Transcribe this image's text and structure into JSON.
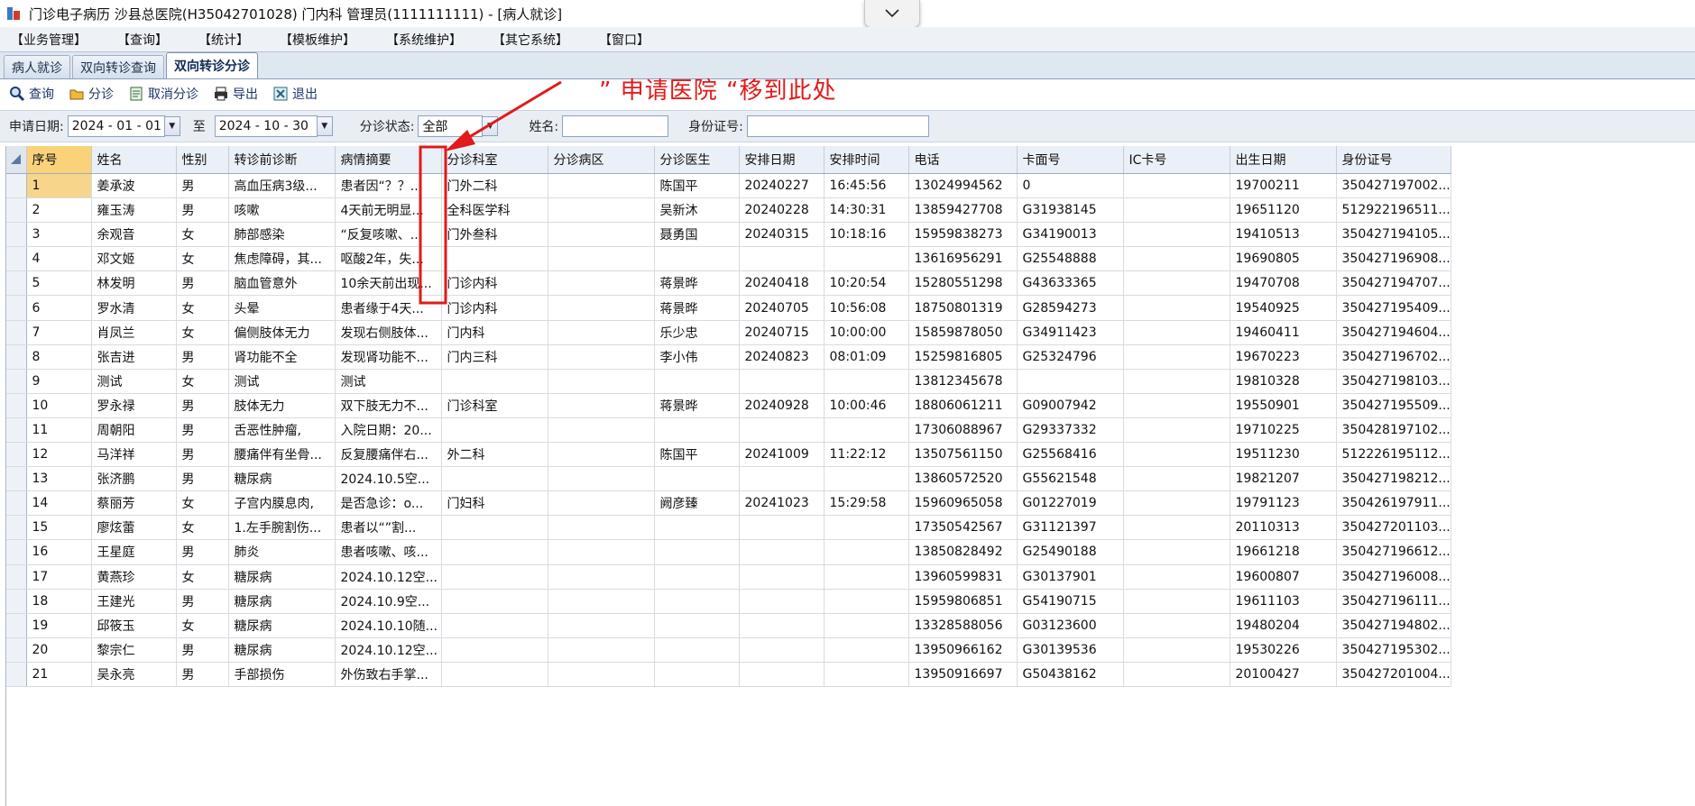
{
  "window": {
    "title": "门诊电子病历  沙县总医院(H35042701028)  门内科  管理员(1111111111) - [病人就诊]"
  },
  "menu": [
    "【业务管理】",
    "【查询】",
    "【统计】",
    "【模板维护】",
    "【系统维护】",
    "【其它系统】",
    "【窗口】"
  ],
  "tabs": [
    {
      "label": "病人就诊",
      "active": false
    },
    {
      "label": "双向转诊查询",
      "active": false
    },
    {
      "label": "双向转诊分诊",
      "active": true
    }
  ],
  "toolbar": {
    "query": "查询",
    "triage": "分诊",
    "cancel_triage": "取消分诊",
    "export": "导出",
    "exit": "退出"
  },
  "annotation": {
    "text": "” 申请医院 “移到此处",
    "color": "#e11a1a"
  },
  "filters": {
    "date_label": "申请日期:",
    "date_from": "2024 - 01 - 01",
    "to_label": "至",
    "date_to": "2024 - 10 - 30",
    "status_label": "分诊状态:",
    "status_value": "全部",
    "name_label": "姓名:",
    "name_value": "",
    "id_label": "身份证号:",
    "id_value": ""
  },
  "table": {
    "columns": [
      "序号",
      "姓名",
      "性别",
      "转诊前诊断",
      "病情摘要",
      "分诊科室",
      "分诊病区",
      "分诊医生",
      "安排日期",
      "安排时间",
      "电话",
      "卡面号",
      "IC卡号",
      "出生日期",
      "身份证号"
    ],
    "rows": [
      [
        "1",
        "姜承波",
        "男",
        "高血压病3级...",
        "患者因“？？...",
        "门外二科",
        "",
        "陈国平",
        "20240227",
        "16:45:56",
        "13024994562",
        "0",
        "",
        "19700211",
        "350427197002..."
      ],
      [
        "2",
        "雍玉涛",
        "男",
        "咳嗽",
        "4天前无明显...",
        "全科医学科",
        "",
        "吴新沐",
        "20240228",
        "14:30:31",
        "13859427708",
        "G31938145",
        "",
        "19651120",
        "512922196511..."
      ],
      [
        "3",
        "余观音",
        "女",
        "肺部感染",
        "“反复咳嗽、...",
        "门外叁科",
        "",
        "聂勇国",
        "20240315",
        "10:18:16",
        "15959838273",
        "G34190013",
        "",
        "19410513",
        "350427194105..."
      ],
      [
        "4",
        "邓文姬",
        "女",
        "焦虑障碍，其...",
        "呕酸2年，失...",
        "",
        "",
        "",
        "",
        "",
        "13616956291",
        "G25548888",
        "",
        "19690805",
        "350427196908..."
      ],
      [
        "5",
        "林发明",
        "男",
        "脑血管意外",
        "10余天前出现...",
        "门诊内科",
        "",
        "蒋景晔",
        "20240418",
        "10:20:54",
        "15280551298",
        "G43633365",
        "",
        "19470708",
        "350427194707..."
      ],
      [
        "6",
        "罗水清",
        "女",
        "头晕",
        "患者缘于4天...",
        "门诊内科",
        "",
        "蒋景晔",
        "20240705",
        "10:56:08",
        "18750801319",
        "G28594273",
        "",
        "19540925",
        "350427195409..."
      ],
      [
        "7",
        "肖凤兰",
        "女",
        "偏侧肢体无力",
        "发现右侧肢体...",
        "门内科",
        "",
        "乐少忠",
        "20240715",
        "10:00:00",
        "15859878050",
        "G34911423",
        "",
        "19460411",
        "350427194604..."
      ],
      [
        "8",
        "张吉进",
        "男",
        "肾功能不全",
        "发现肾功能不...",
        "门内三科",
        "",
        "李小伟",
        "20240823",
        "08:01:09",
        "15259816805",
        "G25324796",
        "",
        "19670223",
        "350427196702..."
      ],
      [
        "9",
        "测试",
        "女",
        "测试",
        "测试",
        "",
        "",
        "",
        "",
        "",
        "13812345678",
        "",
        "",
        "19810328",
        "350427198103..."
      ],
      [
        "10",
        "罗永禄",
        "男",
        "肢体无力",
        "双下肢无力不...",
        "门诊科室",
        "",
        "蒋景晔",
        "20240928",
        "10:00:46",
        "18806061211",
        "G09007942",
        "",
        "19550901",
        "350427195509..."
      ],
      [
        "11",
        "周朝阳",
        "男",
        "舌恶性肿瘤,",
        "入院日期：20...",
        "",
        "",
        "",
        "",
        "",
        "17306088967",
        "G29337332",
        "",
        "19710225",
        "350428197102..."
      ],
      [
        "12",
        "马洋祥",
        "男",
        "腰痛伴有坐骨...",
        "反复腰痛伴右...",
        "外二科",
        "",
        "陈国平",
        "20241009",
        "11:22:12",
        "13507561150",
        "G25568416",
        "",
        "19511230",
        "512226195112..."
      ],
      [
        "13",
        "张济鹏",
        "男",
        "糖尿病",
        "2024.10.5空...",
        "",
        "",
        "",
        "",
        "",
        "13860572520",
        "G55621548",
        "",
        "19821207",
        "350427198212..."
      ],
      [
        "14",
        "蔡丽芳",
        "女",
        "子宫内膜息肉,",
        "是否急诊：o...",
        "门妇科",
        "",
        "阙彦臻",
        "20241023",
        "15:29:58",
        "15960965058",
        "G01227019",
        "",
        "19791123",
        "350426197911..."
      ],
      [
        "15",
        "廖炫蕾",
        "女",
        "1.左手腕割伤...",
        "患者以“”割...",
        "",
        "",
        "",
        "",
        "",
        "17350542567",
        "G31121397",
        "",
        "20110313",
        "350427201103..."
      ],
      [
        "16",
        "王星庭",
        "男",
        "肺炎",
        "患者咳嗽、咳...",
        "",
        "",
        "",
        "",
        "",
        "13850828492",
        "G25490188",
        "",
        "19661218",
        "350427196612..."
      ],
      [
        "17",
        "黄燕珍",
        "女",
        "糖尿病",
        "2024.10.12空...",
        "",
        "",
        "",
        "",
        "",
        "13960599831",
        "G30137901",
        "",
        "19600807",
        "350427196008..."
      ],
      [
        "18",
        "王建光",
        "男",
        "糖尿病",
        "2024.10.9空...",
        "",
        "",
        "",
        "",
        "",
        "15959806851",
        "G54190715",
        "",
        "19611103",
        "350427196111..."
      ],
      [
        "19",
        "邱筱玉",
        "女",
        "糖尿病",
        "2024.10.10随...",
        "",
        "",
        "",
        "",
        "",
        "13328588056",
        "G03123600",
        "",
        "19480204",
        "350427194802..."
      ],
      [
        "20",
        "黎宗仁",
        "男",
        "糖尿病",
        "2024.10.12空...",
        "",
        "",
        "",
        "",
        "",
        "13950966162",
        "G30139536",
        "",
        "19530226",
        "350427195302..."
      ],
      [
        "21",
        "吴永亮",
        "男",
        "手部损伤",
        "外伤致右手掌...",
        "",
        "",
        "",
        "",
        "",
        "13950916697",
        "G50438162",
        "",
        "20100427",
        "350427201004..."
      ]
    ]
  }
}
